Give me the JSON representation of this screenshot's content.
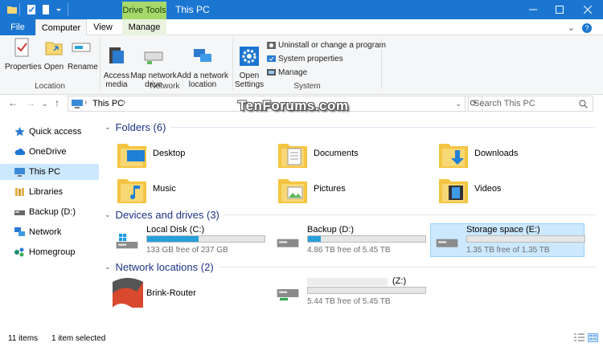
{
  "window": {
    "title": "This PC",
    "contextual_tab_group": "Drive Tools",
    "accent_color": "#1b76d1",
    "contextual_color": "#a6d96a"
  },
  "ribbon_tabs": {
    "file": "File",
    "computer": "Computer",
    "view": "View",
    "manage": "Manage"
  },
  "ribbon": {
    "location": {
      "label": "Location",
      "properties": "Properties",
      "open": "Open",
      "rename": "Rename"
    },
    "network": {
      "label": "Network",
      "access_media": "Access\nmedia",
      "map_network_drive": "Map network\ndrive",
      "add_network_location": "Add a network\nlocation"
    },
    "system": {
      "label": "System",
      "open_settings": "Open\nSettings",
      "uninstall": "Uninstall or change a program",
      "system_properties": "System properties",
      "manage": "Manage"
    }
  },
  "address": {
    "path": "This PC",
    "search_placeholder": "Search This PC"
  },
  "watermark": "TenForums.com",
  "nav_pane": {
    "items": [
      {
        "label": "Quick access",
        "icon": "star-icon"
      },
      {
        "label": "OneDrive",
        "icon": "cloud-icon"
      },
      {
        "label": "This PC",
        "icon": "computer-icon"
      },
      {
        "label": "Libraries",
        "icon": "libraries-icon"
      },
      {
        "label": "Backup (D:)",
        "icon": "drive-icon"
      },
      {
        "label": "Network",
        "icon": "network-icon"
      },
      {
        "label": "Homegroup",
        "icon": "homegroup-icon"
      }
    ]
  },
  "groups": {
    "folders": "Folders (6)",
    "devices": "Devices and drives (3)",
    "network_locations": "Network locations (2)"
  },
  "folders": [
    {
      "label": "Desktop",
      "icon": "desktop-folder-icon"
    },
    {
      "label": "Documents",
      "icon": "documents-folder-icon"
    },
    {
      "label": "Downloads",
      "icon": "downloads-folder-icon"
    },
    {
      "label": "Music",
      "icon": "music-folder-icon"
    },
    {
      "label": "Pictures",
      "icon": "pictures-folder-icon"
    },
    {
      "label": "Videos",
      "icon": "videos-folder-icon"
    }
  ],
  "drives": [
    {
      "name": "Local Disk (C:)",
      "free_text": "133 GB free of 237 GB",
      "used_fraction": 0.44
    },
    {
      "name": "Backup (D:)",
      "free_text": "4.86 TB free of 5.45 TB",
      "used_fraction": 0.11
    },
    {
      "name": "Storage space (E:)",
      "free_text": "1.35 TB free of 1.35 TB",
      "used_fraction": 0.0
    }
  ],
  "network_locations": [
    {
      "name": "Brink-Router"
    },
    {
      "name": "(Z:)",
      "free_text": "5.44 TB free of 5.45 TB",
      "used_fraction": 0.0
    }
  ],
  "status": {
    "items": "11 items",
    "selected": "1 item selected"
  }
}
